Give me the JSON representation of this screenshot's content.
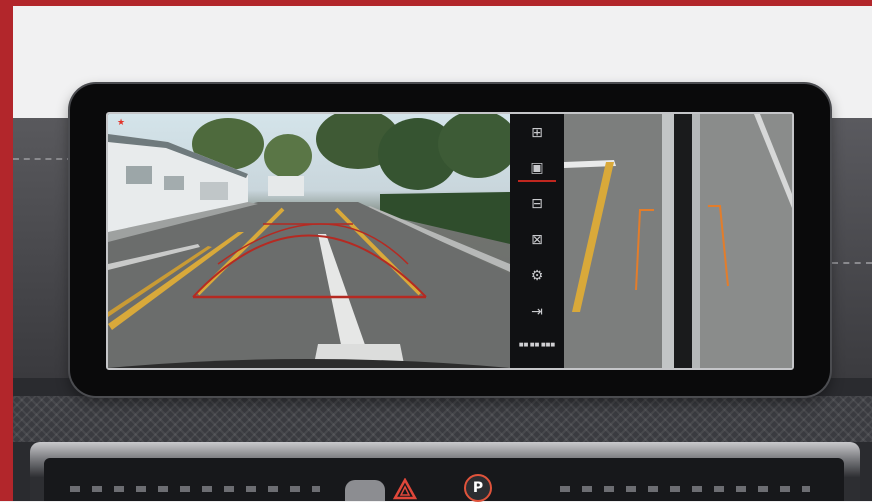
{
  "colors": {
    "frame_red": "#b2262b",
    "guide_red": "#b52a22",
    "lane_yellow": "#d9a93a",
    "guide_orange": "#e37d2b",
    "active_tab_red": "#c0271f"
  },
  "camera_view": {
    "recording_indicator": "★",
    "guide_lines": [
      "red-trajectory-arc",
      "yellow-parking-guide"
    ]
  },
  "sidebar": {
    "items": [
      {
        "icon": "top-view-car-icon",
        "glyph": "⊞"
      },
      {
        "icon": "split-view-icon",
        "glyph": "▣",
        "active": true
      },
      {
        "icon": "front-car-icon",
        "glyph": "⊟"
      },
      {
        "icon": "car-side-icon",
        "glyph": "⊠"
      },
      {
        "icon": "settings-icon",
        "glyph": "⚙"
      },
      {
        "icon": "exit-icon",
        "glyph": "⇥"
      }
    ],
    "caption": "■■ ■■ ■■■"
  },
  "dashboard": {
    "parking_button_glyph": "P"
  }
}
